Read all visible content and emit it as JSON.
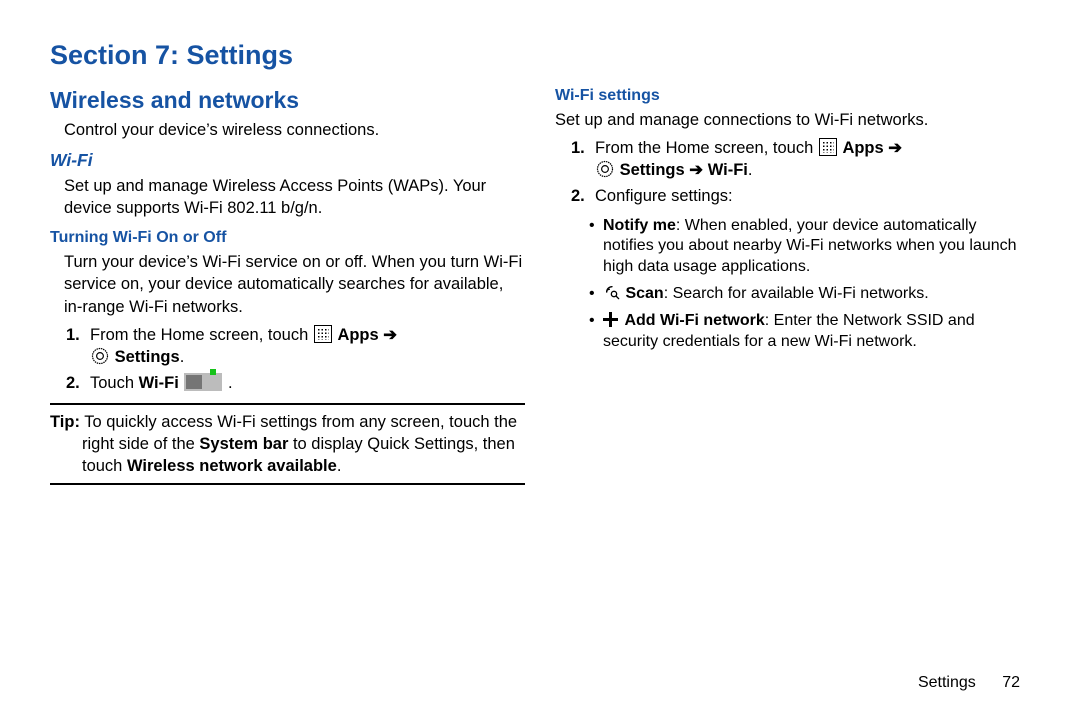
{
  "section_title": "Section 7: Settings",
  "footer": {
    "label": "Settings",
    "page": "72"
  },
  "left": {
    "heading": "Wireless and networks",
    "intro": "Control your device’s wireless connections.",
    "wifi_heading": "Wi-Fi",
    "wifi_desc": "Set up and manage Wireless Access Points (WAPs). Your device supports Wi-Fi 802.11 b/g/n.",
    "turning_heading": "Turning Wi-Fi On or Off",
    "turning_desc": "Turn your device’s Wi-Fi service on or off. When you turn Wi-Fi service on, your device automatically searches for available, in-range Wi-Fi networks.",
    "step1_a": "From the Home screen, touch ",
    "apps_label": "Apps",
    "arrow": "➔",
    "settings_label": "Settings",
    "step2_a": "Touch ",
    "step2_b": "Wi-Fi",
    "tip_label": "Tip:",
    "tip_text_a": " To quickly access Wi-Fi settings from any screen, touch the right side of the ",
    "tip_bold1": "System bar",
    "tip_text_b": " to display Quick Settings, then touch ",
    "tip_bold2": "Wireless network available",
    "num1": "1.",
    "num2": "2."
  },
  "right": {
    "heading": "Wi-Fi settings",
    "intro": "Set up and manage connections to Wi-Fi networks.",
    "step1_a": "From the Home screen, touch ",
    "apps_label": "Apps",
    "arrow": "➔",
    "settings_label": "Settings",
    "wifi_label": "Wi-Fi",
    "step2": "Configure settings:",
    "b1_bold": "Notify me",
    "b1_text": ": When enabled, your device automatically notifies you about nearby Wi-Fi networks when you launch high data usage applications.",
    "b2_bold": "Scan",
    "b2_text": ": Search for available Wi-Fi networks.",
    "b3_bold": "Add Wi-Fi network",
    "b3_text": ": Enter the Network SSID and security credentials for a new Wi-Fi network.",
    "num1": "1.",
    "num2": "2.",
    "bullet": "•"
  }
}
